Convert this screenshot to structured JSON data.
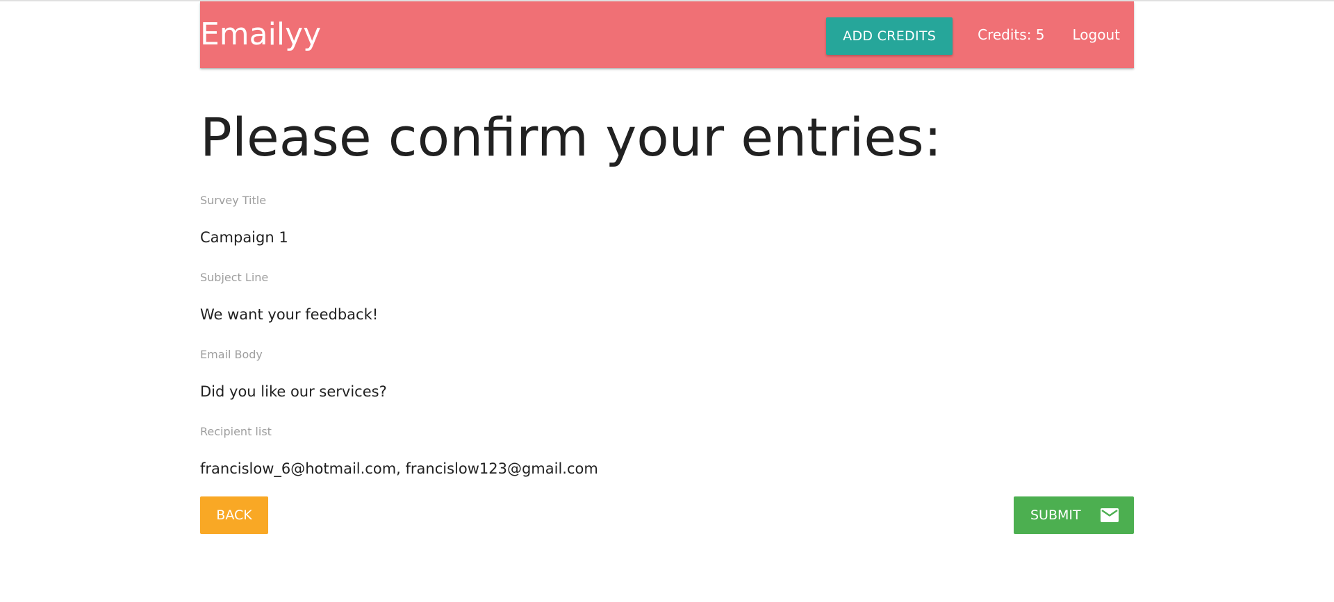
{
  "navbar": {
    "brand": "Emailyy",
    "add_credits_label": "ADD CREDITS",
    "credits_text": "Credits: 5",
    "logout_label": "Logout"
  },
  "page": {
    "title": "Please confirm your entries:"
  },
  "fields": [
    {
      "label": "Survey Title",
      "value": "Campaign 1"
    },
    {
      "label": "Subject Line",
      "value": "We want your feedback!"
    },
    {
      "label": "Email Body",
      "value": "Did you like our services?"
    },
    {
      "label": "Recipient list",
      "value": "francislow_6@hotmail.com, francislow123@gmail.com"
    }
  ],
  "actions": {
    "back_label": "BACK",
    "submit_label": "SUBMIT",
    "submit_icon": "mail-icon"
  },
  "colors": {
    "navbar": "#f07075",
    "add_credits": "#26a69a",
    "back": "#f9a825",
    "submit": "#4caf50"
  }
}
